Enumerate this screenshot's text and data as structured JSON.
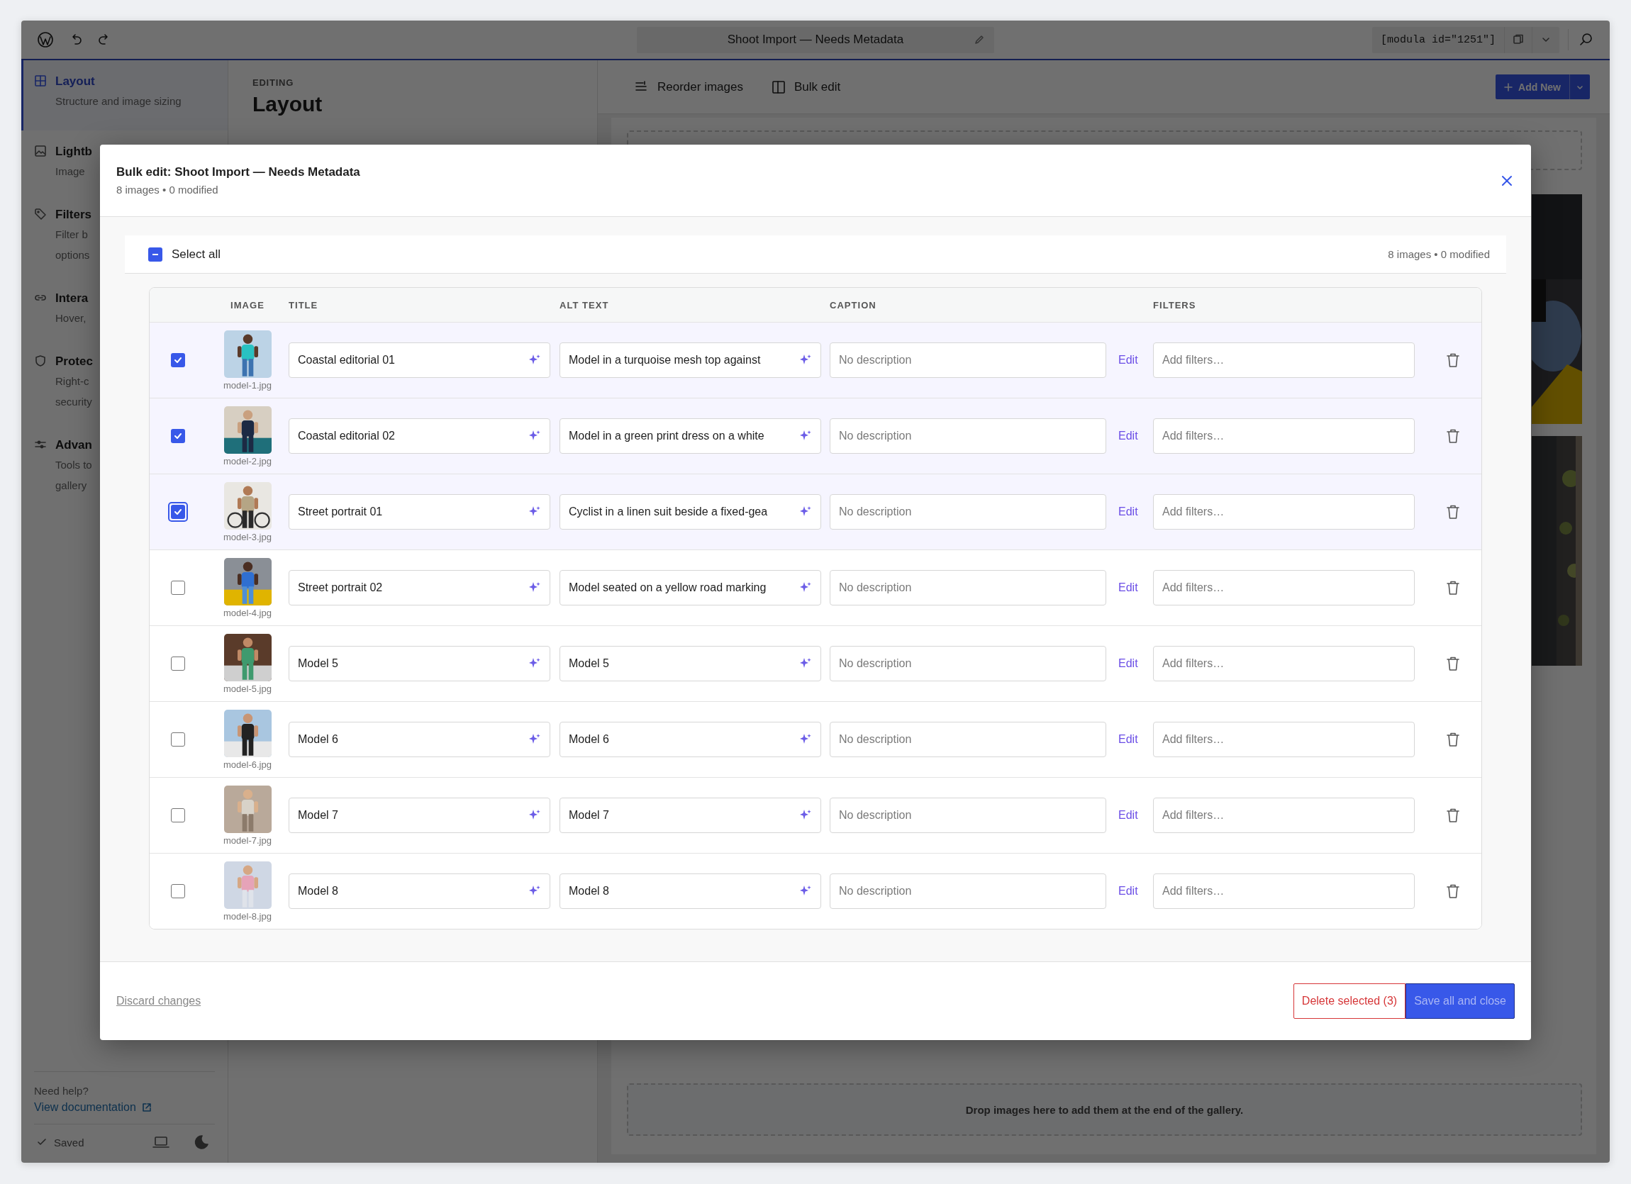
{
  "topbar": {
    "title": "Shoot Import — Needs Metadata",
    "shortcode": "[modula id=\"1251\"]"
  },
  "sidebar": {
    "items": [
      {
        "title": "Layout",
        "description": [
          "Structure and image sizing"
        ],
        "selected": true
      },
      {
        "title": "Lightb",
        "description": [
          "Image"
        ],
        "selected": false
      },
      {
        "title": "Filters",
        "description": [
          "Filter b",
          "options"
        ],
        "selected": false
      },
      {
        "title": "Intera",
        "description": [
          "Hover,"
        ],
        "selected": false
      },
      {
        "title": "Protec",
        "description": [
          "Right-c",
          "security"
        ],
        "selected": false
      },
      {
        "title": "Advan",
        "description": [
          "Tools to",
          "gallery"
        ],
        "selected": false
      }
    ],
    "help_label": "Need help?",
    "help_link": "View documentation",
    "status": "Saved"
  },
  "editor": {
    "eyebrow": "EDITING",
    "heading": "Layout"
  },
  "canvas": {
    "toolbar": [
      {
        "label": "Reorder images"
      },
      {
        "label": "Bulk edit"
      }
    ],
    "add_button": "Add New",
    "drop_hint": "Drop images here to add them at the end of the gallery."
  },
  "modal": {
    "title": "Bulk edit: Shoot Import — Needs Metadata",
    "subtitle": "8 images • 0 modified",
    "select_all": {
      "label": "Select all",
      "indeterminate": true
    },
    "summary": "8 images • 0 modified",
    "columns": [
      "IMAGE",
      "TITLE",
      "ALT TEXT",
      "CAPTION",
      "FILTERS"
    ],
    "rows": [
      {
        "selected": true,
        "focused": false,
        "filename": "model-1.jpg",
        "title": "Coastal editorial 01",
        "alt": "Model in a turquoise mesh top against",
        "caption_placeholder": "No description",
        "edit_label": "Edit",
        "filters_placeholder": "Add filters…"
      },
      {
        "selected": true,
        "focused": false,
        "filename": "model-2.jpg",
        "title": "Coastal editorial 02",
        "alt": "Model in a green print dress on a white",
        "caption_placeholder": "No description",
        "edit_label": "Edit",
        "filters_placeholder": "Add filters…"
      },
      {
        "selected": true,
        "focused": true,
        "filename": "model-3.jpg",
        "title": "Street portrait 01",
        "alt": "Cyclist in a linen suit beside a fixed-gea",
        "caption_placeholder": "No description",
        "edit_label": "Edit",
        "filters_placeholder": "Add filters…"
      },
      {
        "selected": false,
        "focused": false,
        "filename": "model-4.jpg",
        "title": "Street portrait 02",
        "alt": "Model seated on a yellow road marking",
        "caption_placeholder": "No description",
        "edit_label": "Edit",
        "filters_placeholder": "Add filters…"
      },
      {
        "selected": false,
        "focused": false,
        "filename": "model-5.jpg",
        "title": "Model 5",
        "alt": "Model 5",
        "caption_placeholder": "No description",
        "edit_label": "Edit",
        "filters_placeholder": "Add filters…"
      },
      {
        "selected": false,
        "focused": false,
        "filename": "model-6.jpg",
        "title": "Model 6",
        "alt": "Model 6",
        "caption_placeholder": "No description",
        "edit_label": "Edit",
        "filters_placeholder": "Add filters…"
      },
      {
        "selected": false,
        "focused": false,
        "filename": "model-7.jpg",
        "title": "Model 7",
        "alt": "Model 7",
        "caption_placeholder": "No description",
        "edit_label": "Edit",
        "filters_placeholder": "Add filters…"
      },
      {
        "selected": false,
        "focused": false,
        "filename": "model-8.jpg",
        "title": "Model 8",
        "alt": "Model 8",
        "caption_placeholder": "No description",
        "edit_label": "Edit",
        "filters_placeholder": "Add filters…"
      }
    ],
    "discard": "Discard changes",
    "delete_button": "Delete selected (3)",
    "save_button": {
      "label": "Save all and close",
      "disabled": true
    }
  }
}
